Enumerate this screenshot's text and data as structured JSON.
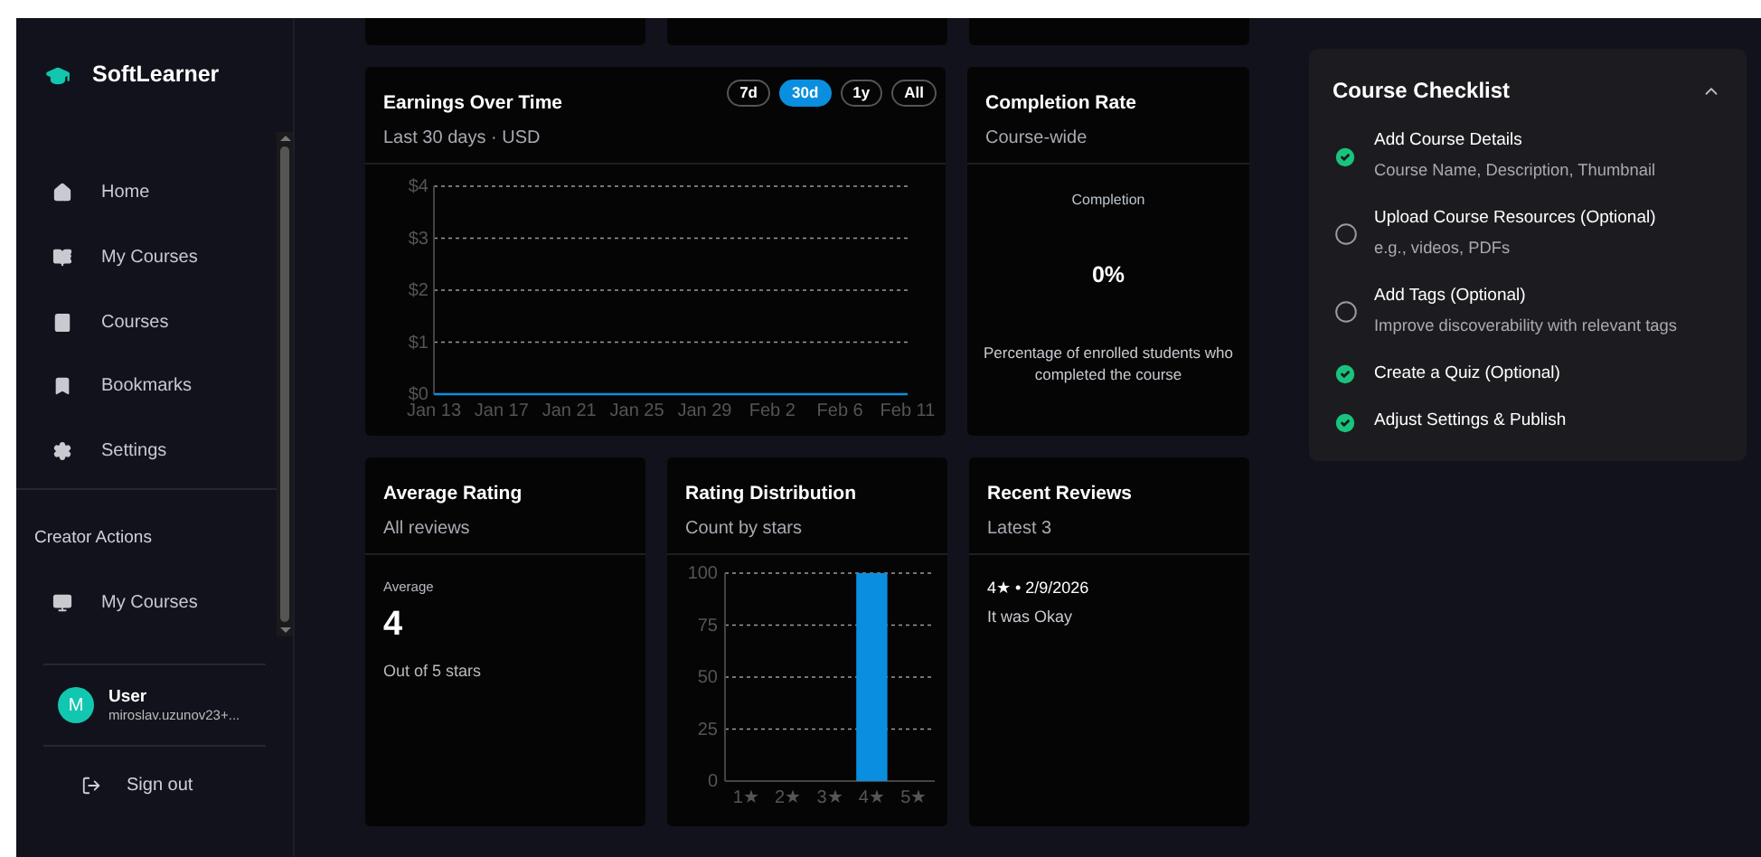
{
  "sidebar": {
    "brand": "SoftLearner",
    "items": [
      {
        "label": "Home",
        "selected": false
      },
      {
        "label": "My Courses",
        "selected": false
      },
      {
        "label": "Courses",
        "selected": false
      },
      {
        "label": "Bookmarks",
        "selected": false
      },
      {
        "label": "Settings",
        "selected": false
      }
    ],
    "section_title": "Creator Actions",
    "creator_items": [
      {
        "label": "My Courses",
        "selected": false
      }
    ],
    "user": {
      "initial": "M",
      "name": "User",
      "email": "miroslav.uzunov23+..."
    },
    "sign_out": "Sign out"
  },
  "earnings": {
    "title": "Earnings Over Time",
    "subtitle": "Last 30 days · USD",
    "ranges": [
      {
        "label": "7d",
        "selected": false
      },
      {
        "label": "30d",
        "selected": true
      },
      {
        "label": "1y",
        "selected": false
      },
      {
        "label": "All",
        "selected": false
      }
    ],
    "chart_data": {
      "type": "line",
      "x": [
        "Jan 13",
        "Jan 17",
        "Jan 21",
        "Jan 25",
        "Jan 29",
        "Feb 2",
        "Feb 6",
        "Feb 11"
      ],
      "series": [
        {
          "color": "#0a8fe0",
          "values": [
            0,
            0,
            0,
            0,
            0,
            0,
            0,
            0
          ]
        }
      ],
      "grid": true,
      "ylim": [
        0,
        4
      ],
      "yticks": [
        {
          "value": 0,
          "label": "$0"
        },
        {
          "value": 1,
          "label": "$1"
        },
        {
          "value": 2,
          "label": "$2"
        },
        {
          "value": 3,
          "label": "$3"
        },
        {
          "value": 4,
          "label": "$4"
        }
      ]
    }
  },
  "completion": {
    "title": "Completion Rate",
    "subtitle": "Course-wide",
    "label": "Completion",
    "value": "0%",
    "caption": "Percentage of enrolled students who completed the course"
  },
  "average": {
    "title": "Average Rating",
    "subtitle": "All reviews",
    "label": "Average",
    "value": "4",
    "caption": "Out of 5 stars"
  },
  "distribution": {
    "title": "Rating Distribution",
    "subtitle": "Count by stars",
    "chart_data": {
      "type": "bar",
      "categories": [
        "1★",
        "2★",
        "3★",
        "4★",
        "5★"
      ],
      "series": [
        {
          "color": "#0a8fe0",
          "values": [
            0,
            0,
            0,
            100,
            0
          ]
        }
      ],
      "grid": true,
      "ylim": [
        0,
        100
      ],
      "yticks": [
        0,
        25,
        50,
        75,
        100
      ]
    }
  },
  "reviews": {
    "title": "Recent Reviews",
    "subtitle": "Latest 3",
    "items": [
      {
        "meta": "4★ • 2/9/2026",
        "text": "It was Okay"
      }
    ]
  },
  "checklist": {
    "title": "Course Checklist",
    "expanded": true,
    "items": [
      {
        "label": "Add Course Details",
        "detail": "Course Name, Description, Thumbnail",
        "checked": true
      },
      {
        "label": "Upload Course Resources (Optional)",
        "detail": "e.g., videos, PDFs",
        "checked": false
      },
      {
        "label": "Add Tags (Optional)",
        "detail": "Improve discoverability with relevant tags",
        "checked": false
      },
      {
        "label": "Create a Quiz (Optional)",
        "checked": true
      },
      {
        "label": "Adjust Settings & Publish",
        "checked": true
      }
    ]
  }
}
